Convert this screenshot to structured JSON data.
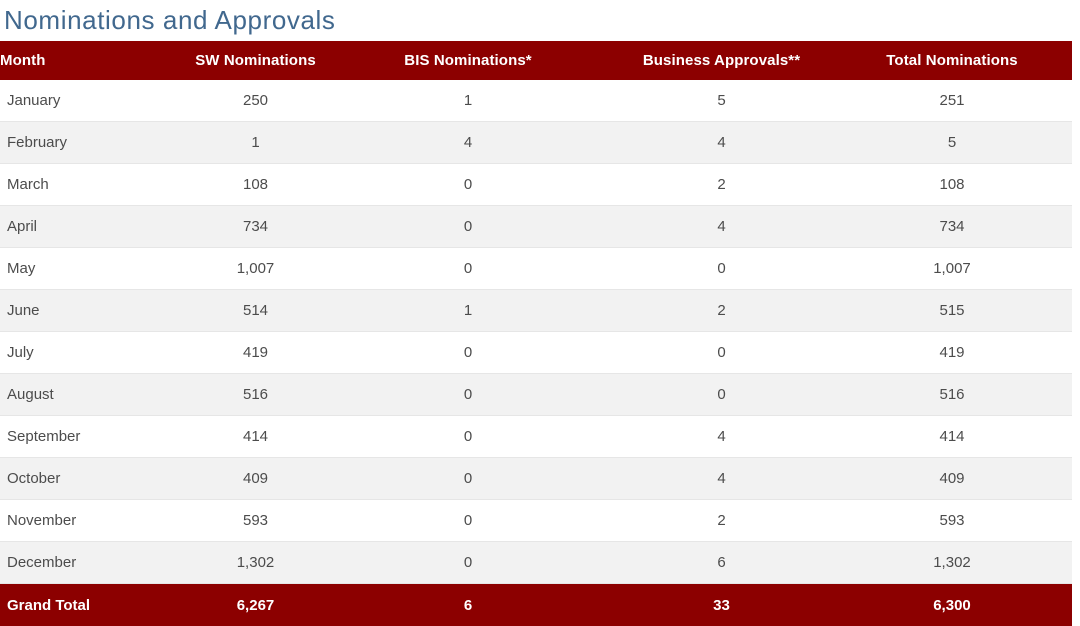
{
  "page": {
    "title": "Nominations and Approvals",
    "title_color": "#41688e",
    "header_bg": "#8c0000",
    "header_text_color": "#ffffff",
    "row_alt_bg": "#f2f2f2",
    "body_text_color": "#4c4c4c"
  },
  "table": {
    "columns": [
      "Month",
      "SW Nominations",
      "BIS Nominations*",
      "Business Approvals**",
      "Total Nominations"
    ],
    "rows": [
      {
        "month": "January",
        "sw": "250",
        "bis": "1",
        "approvals": "5",
        "total": "251"
      },
      {
        "month": "February",
        "sw": "1",
        "bis": "4",
        "approvals": "4",
        "total": "5"
      },
      {
        "month": "March",
        "sw": "108",
        "bis": "0",
        "approvals": "2",
        "total": "108"
      },
      {
        "month": "April",
        "sw": "734",
        "bis": "0",
        "approvals": "4",
        "total": "734"
      },
      {
        "month": "May",
        "sw": "1,007",
        "bis": "0",
        "approvals": "0",
        "total": "1,007"
      },
      {
        "month": "June",
        "sw": "514",
        "bis": "1",
        "approvals": "2",
        "total": "515"
      },
      {
        "month": "July",
        "sw": "419",
        "bis": "0",
        "approvals": "0",
        "total": "419"
      },
      {
        "month": "August",
        "sw": "516",
        "bis": "0",
        "approvals": "0",
        "total": "516"
      },
      {
        "month": "September",
        "sw": "414",
        "bis": "0",
        "approvals": "4",
        "total": "414"
      },
      {
        "month": "October",
        "sw": "409",
        "bis": "0",
        "approvals": "4",
        "total": "409"
      },
      {
        "month": "November",
        "sw": "593",
        "bis": "0",
        "approvals": "2",
        "total": "593"
      },
      {
        "month": "December",
        "sw": "1,302",
        "bis": "0",
        "approvals": "6",
        "total": "1,302"
      }
    ],
    "footer": {
      "label": "Grand Total",
      "sw": "6,267",
      "bis": "6",
      "approvals": "33",
      "total": "6,300"
    }
  },
  "chart_data": {
    "type": "table",
    "title": "Nominations and Approvals",
    "columns": [
      "Month",
      "SW Nominations",
      "BIS Nominations*",
      "Business Approvals**",
      "Total Nominations"
    ],
    "categories": [
      "January",
      "February",
      "March",
      "April",
      "May",
      "June",
      "July",
      "August",
      "September",
      "October",
      "November",
      "December"
    ],
    "series": [
      {
        "name": "SW Nominations",
        "values": [
          250,
          1,
          108,
          734,
          1007,
          514,
          419,
          516,
          414,
          409,
          593,
          1302
        ]
      },
      {
        "name": "BIS Nominations*",
        "values": [
          1,
          4,
          0,
          0,
          0,
          1,
          0,
          0,
          0,
          0,
          0,
          0
        ]
      },
      {
        "name": "Business Approvals**",
        "values": [
          5,
          4,
          2,
          4,
          0,
          2,
          0,
          0,
          4,
          4,
          2,
          6
        ]
      },
      {
        "name": "Total Nominations",
        "values": [
          251,
          5,
          108,
          734,
          1007,
          515,
          419,
          516,
          414,
          409,
          593,
          1302
        ]
      }
    ],
    "totals": {
      "SW Nominations": 6267,
      "BIS Nominations*": 6,
      "Business Approvals**": 33,
      "Total Nominations": 6300
    },
    "xlabel": "Month",
    "ylabel": "",
    "grid": true,
    "legend": "none"
  }
}
